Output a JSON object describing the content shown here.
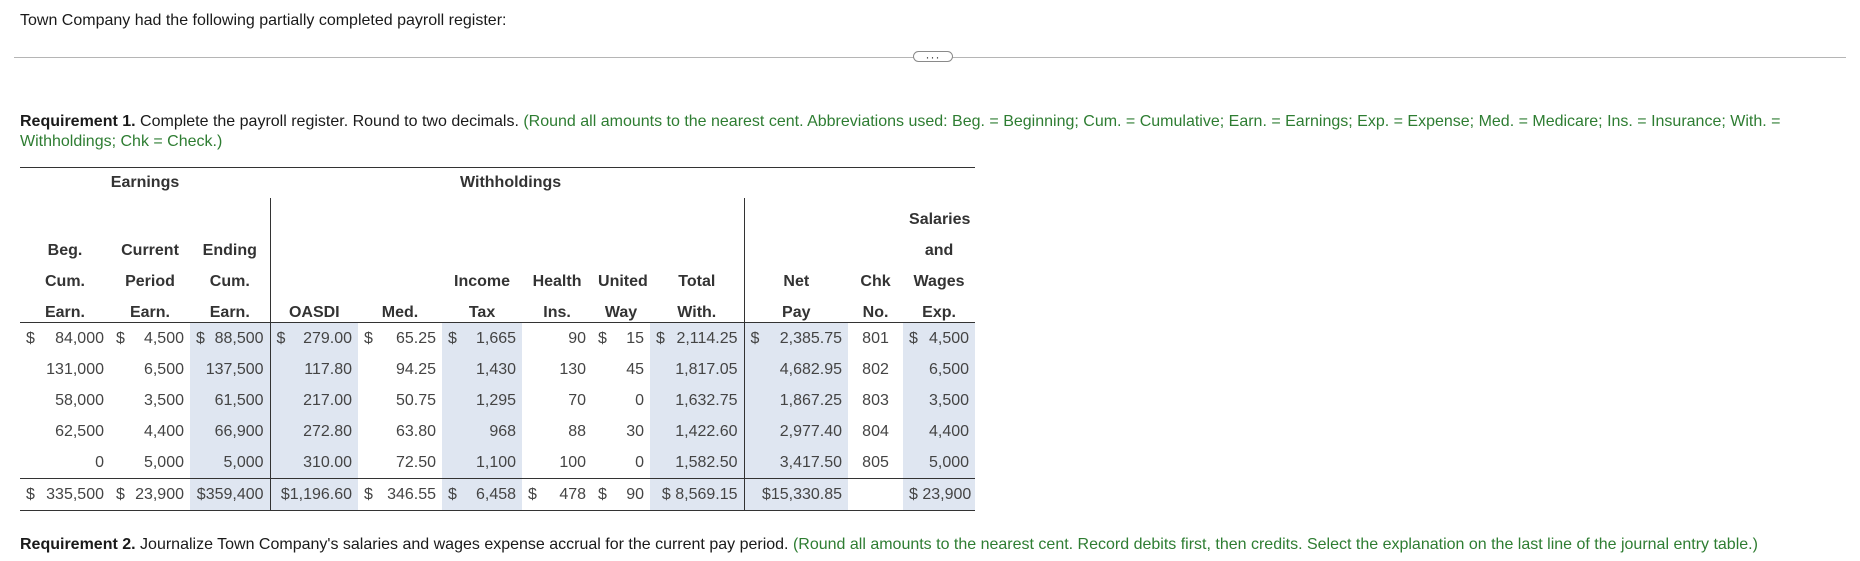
{
  "intro": "Town Company had the following partially completed payroll register:",
  "more_button": "···",
  "requirement1": {
    "label": "Requirement 1.",
    "text": " Complete the payroll register. Round to two decimals. ",
    "hint": "(Round all amounts to the nearest cent. Abbreviations used: Beg. = Beginning; Cum. = Cumulative; Earn. = Earnings; Exp. = Expense; Med. = Medicare; Ins. = Insurance; With. = Withholdings; Chk = Check.)"
  },
  "requirement2": {
    "label": "Requirement 2.",
    "text": " Journalize Town Company's salaries and wages expense accrual for the current pay period. ",
    "hint": "(Round all amounts to the nearest cent. Record debits first, then credits. Select the explanation on the last line of the journal entry table.)"
  },
  "table": {
    "group_earnings": "Earnings",
    "group_withholdings": "Withholdings",
    "header_lines": [
      [
        "",
        "",
        "",
        "",
        "",
        "",
        "",
        "",
        "",
        "",
        "",
        "Salaries"
      ],
      [
        "Beg.",
        "Current",
        "Ending",
        "",
        "",
        "",
        "",
        "",
        "",
        "",
        "",
        "and"
      ],
      [
        "Cum.",
        "Period",
        "Cum.",
        "",
        "",
        "Income",
        "Health",
        "United",
        "Total",
        "Net",
        "Chk",
        "Wages"
      ],
      [
        "Earn.",
        "Earn.",
        "Earn.",
        "OASDI",
        "Med.",
        "Tax",
        "Ins.",
        "Way",
        "With.",
        "Pay",
        "No.",
        "Exp."
      ]
    ],
    "rows": [
      {
        "beg": "84,000",
        "cur": "4,500",
        "end": "88,500",
        "oasdi": "279.00",
        "med": "65.25",
        "tax": "1,665",
        "health": "90",
        "uw": "15",
        "total": "2,114.25",
        "net": "2,385.75",
        "chk": "801",
        "exp": "4,500"
      },
      {
        "beg": "131,000",
        "cur": "6,500",
        "end": "137,500",
        "oasdi": "117.80",
        "med": "94.25",
        "tax": "1,430",
        "health": "130",
        "uw": "45",
        "total": "1,817.05",
        "net": "4,682.95",
        "chk": "802",
        "exp": "6,500"
      },
      {
        "beg": "58,000",
        "cur": "3,500",
        "end": "61,500",
        "oasdi": "217.00",
        "med": "50.75",
        "tax": "1,295",
        "health": "70",
        "uw": "0",
        "total": "1,632.75",
        "net": "1,867.25",
        "chk": "803",
        "exp": "3,500"
      },
      {
        "beg": "62,500",
        "cur": "4,400",
        "end": "66,900",
        "oasdi": "272.80",
        "med": "63.80",
        "tax": "968",
        "health": "88",
        "uw": "30",
        "total": "1,422.60",
        "net": "2,977.40",
        "chk": "804",
        "exp": "4,400"
      },
      {
        "beg": "0",
        "cur": "5,000",
        "end": "5,000",
        "oasdi": "310.00",
        "med": "72.50",
        "tax": "1,100",
        "health": "100",
        "uw": "0",
        "total": "1,582.50",
        "net": "3,417.50",
        "chk": "805",
        "exp": "5,000"
      }
    ],
    "totals": {
      "beg": "335,500",
      "cur": "23,900",
      "end": "$359,400",
      "oasdi": "$1,196.60",
      "med": "346.55",
      "tax": "6,458",
      "health": "478",
      "uw": "90",
      "total": "$ 8,569.15",
      "net": "$15,330.85",
      "chk": "",
      "exp": "$ 23,900"
    }
  }
}
